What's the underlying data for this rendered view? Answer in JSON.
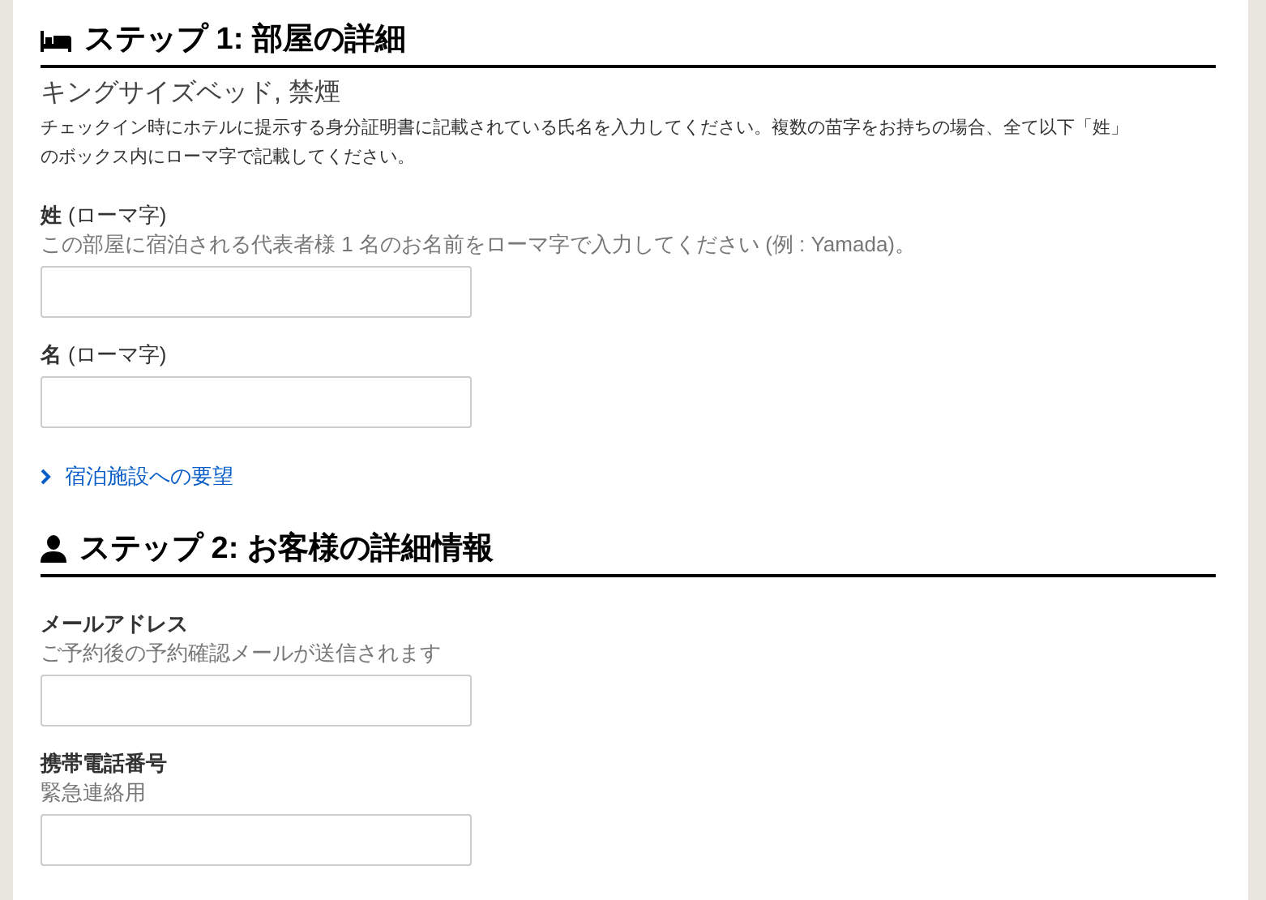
{
  "sections": [
    {
      "kind": "room",
      "heading": "ステップ 1: 部屋の詳細",
      "room": "キングサイズベッド, 禁煙",
      "notice": "チェックイン時にホテルに提示する身分証明書に記載されている氏名を入力してください。複数の苗字をお持ちの場合、全て以下「姓」のボックス内にローマ字で記載してください。",
      "fields": [
        {
          "label": "姓",
          "suffix": "(ローマ字)",
          "hint": "この部屋に宿泊される代表者様 1 名のお名前をローマ字で入力してください (例 : Yamada)。"
        },
        {
          "label": "名",
          "suffix": "(ローマ字)"
        }
      ],
      "link": "宿泊施設への要望"
    },
    {
      "kind": "guest",
      "heading": "ステップ 2: お客様の詳細情報",
      "fields": [
        {
          "label": "メールアドレス",
          "hint": "ご予約後の予約確認メールが送信されます"
        },
        {
          "label": "携帯電話番号",
          "hint": "緊急連絡用"
        }
      ]
    }
  ]
}
